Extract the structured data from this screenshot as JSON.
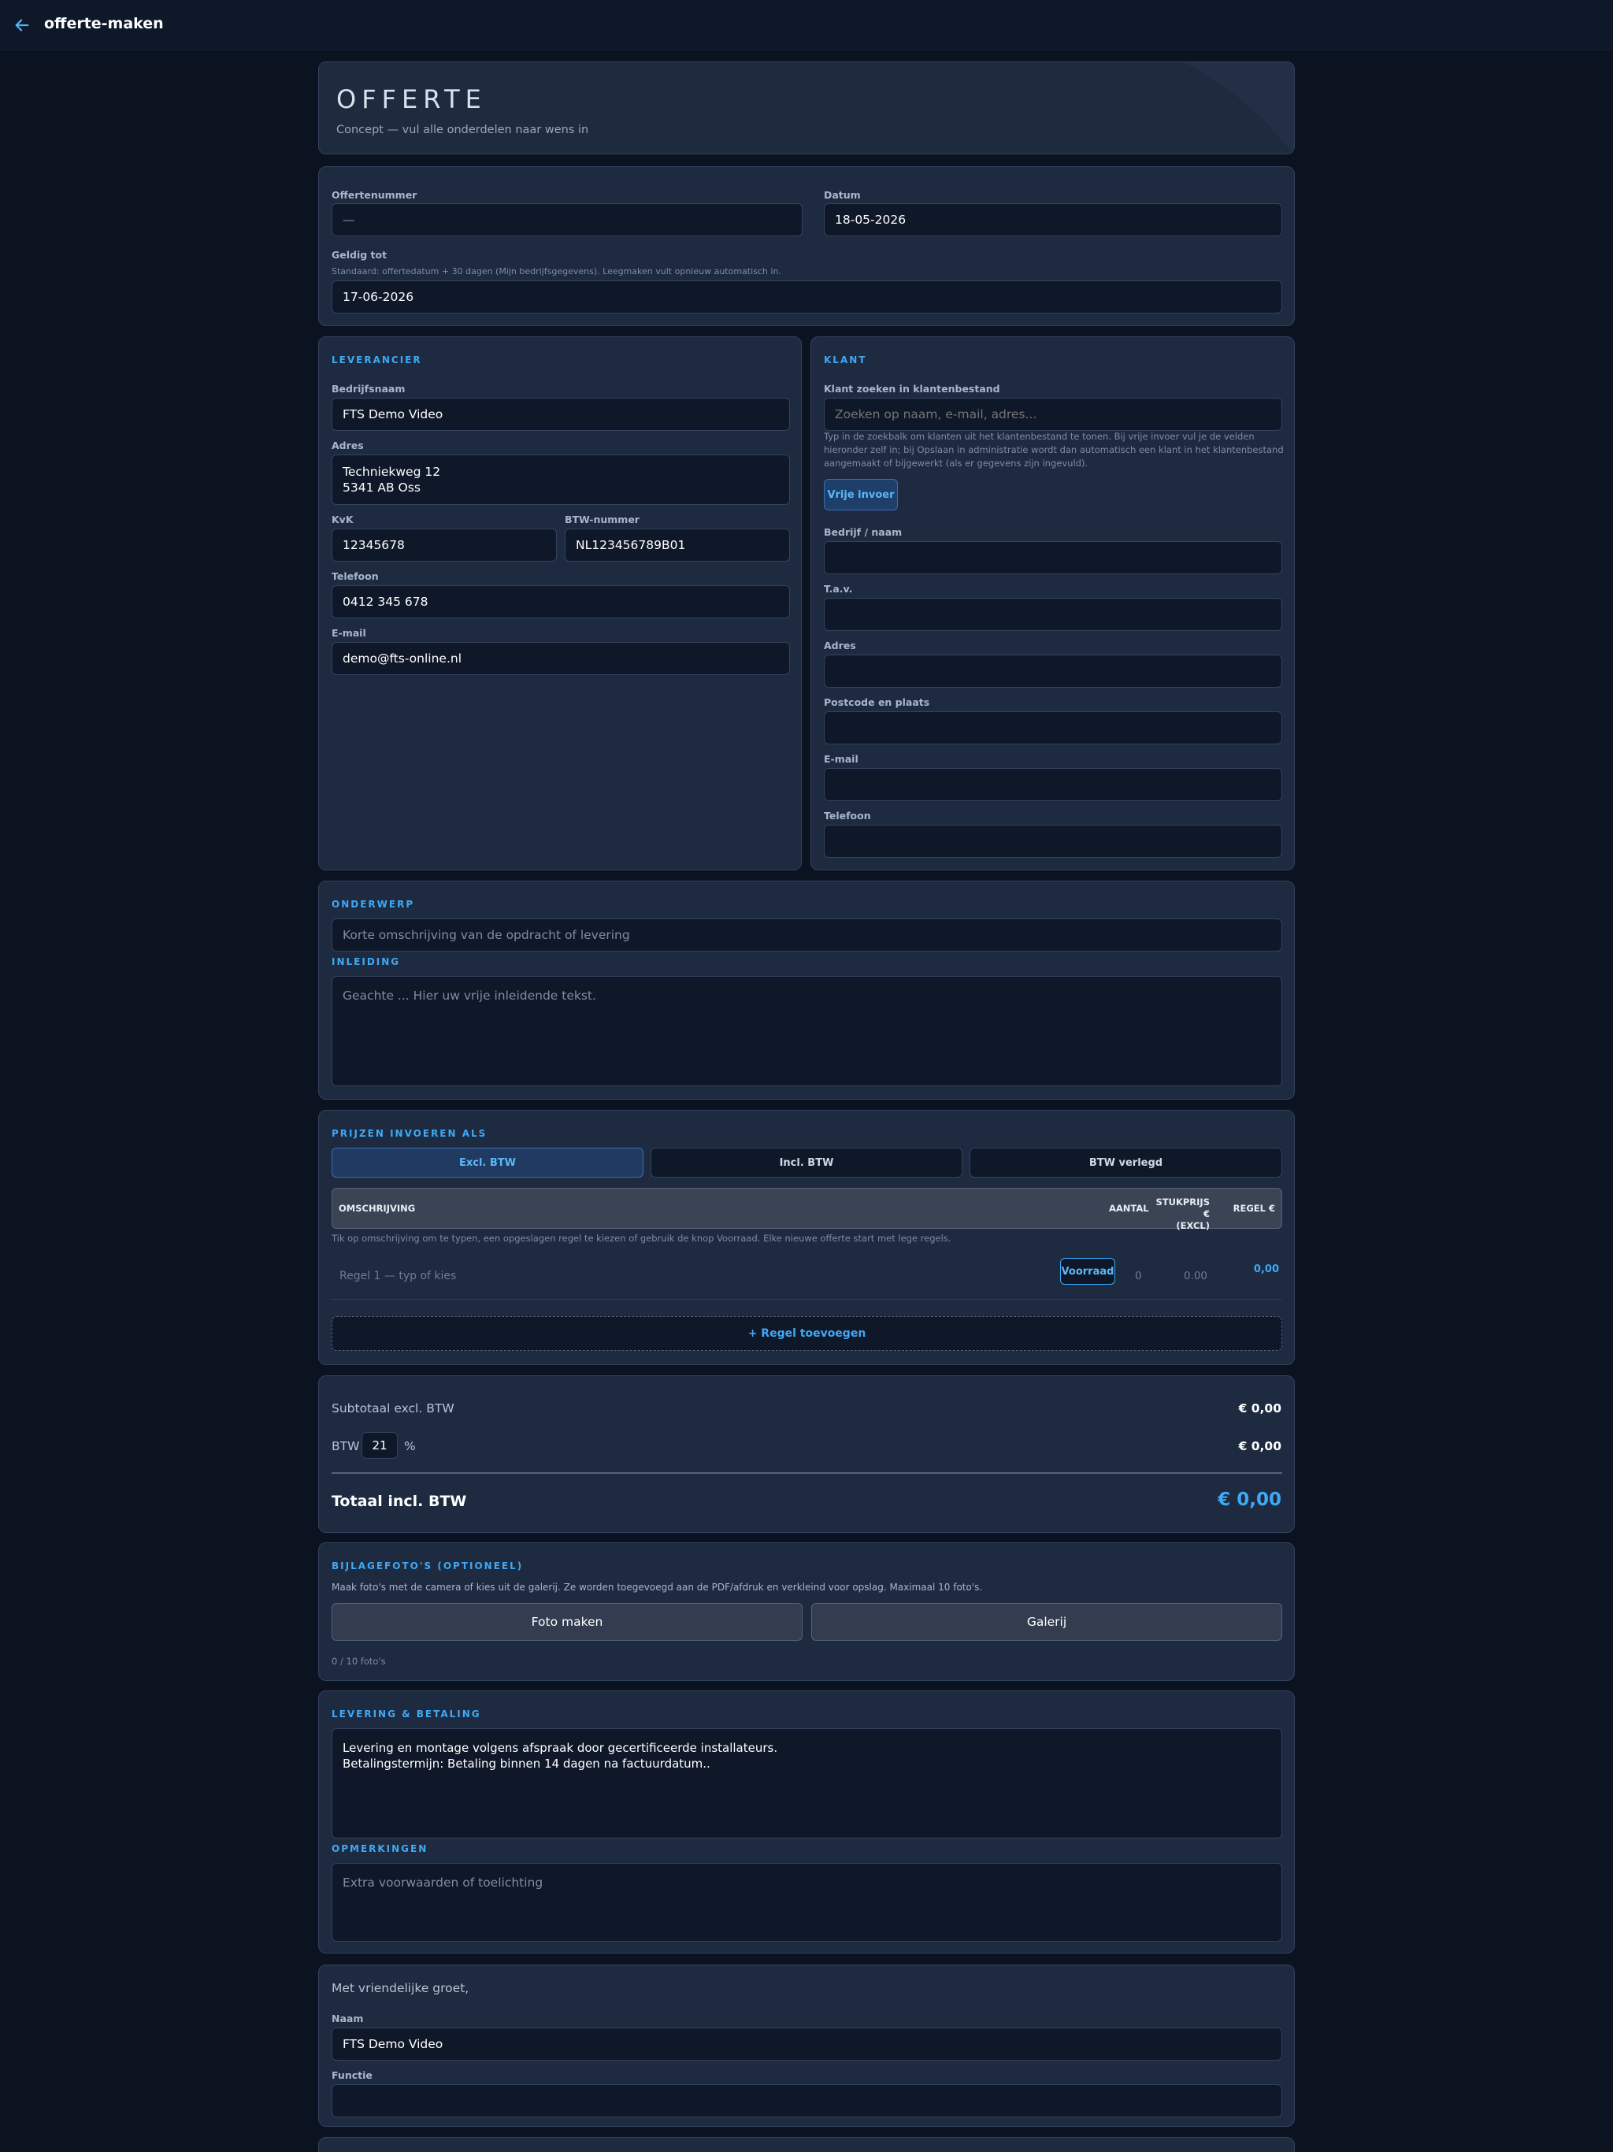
{
  "topbar": {
    "title": "offerte-maken",
    "back_icon": "arrow-left-icon"
  },
  "header": {
    "title": "OFFERTE",
    "subtitle": "Concept — vul alle onderdelen naar wens in"
  },
  "meta": {
    "number_label": "Offertenummer",
    "number_value": "—",
    "date_label": "Datum",
    "date_value": "18-05-2026",
    "valid_label": "Geldig tot",
    "valid_hint": "Standaard: offertedatum + 30 dagen (Mijn bedrijfsgegevens). Leegmaken vult opnieuw automatisch in.",
    "valid_value": "17-06-2026"
  },
  "supplier": {
    "section": "LEVERANCIER",
    "company_label": "Bedrijfsnaam",
    "company_value": "FTS Demo Video",
    "address_label": "Adres",
    "address_value": "Techniekweg 12\n5341 AB Oss",
    "kvk_label": "KvK",
    "kvk_value": "12345678",
    "vat_label": "BTW-nummer",
    "vat_value": "NL123456789B01",
    "phone_label": "Telefoon",
    "phone_value": "0412 345 678",
    "email_label": "E-mail",
    "email_value": "demo@fts-online.nl"
  },
  "client": {
    "section": "KLANT",
    "search_label": "Klant zoeken in klantenbestand",
    "search_placeholder": "Zoeken op naam, e-mail, adres...",
    "search_hint": "Typ in de zoekbalk om klanten uit het klantenbestand te tonen. Bij vrije invoer vul je de velden hieronder zelf in; bij Opslaan in administratie wordt dan automatisch een klant in het klantenbestand aangemaakt of bijgewerkt (als er gegevens zijn ingevuld).",
    "free_entry_label": "Vrije invoer",
    "company_label": "Bedrijf / naam",
    "company_value": "",
    "attn_label": "T.a.v.",
    "attn_value": "",
    "address_label": "Adres",
    "address_value": "",
    "postal_label": "Postcode en plaats",
    "postal_value": "",
    "email_label": "E-mail",
    "email_value": "",
    "phone_label": "Telefoon",
    "phone_value": ""
  },
  "subject": {
    "section": "ONDERWERP",
    "placeholder": "Korte omschrijving van de opdracht of levering",
    "intro_section": "INLEIDING",
    "intro_placeholder": "Geachte ...  Hier uw vrije inleidende tekst."
  },
  "prices": {
    "section": "PRIJZEN INVOEREN ALS",
    "modes": [
      "Excl. BTW",
      "Incl. BTW",
      "BTW verlegd"
    ],
    "active_mode": "Excl. BTW",
    "columns": {
      "description": "OMSCHRIJVING",
      "quantity": "AANTAL",
      "unit_price_1": "STUKPRIJS €",
      "unit_price_2": "(EXCL)",
      "line": "REGEL €"
    },
    "table_hint": "Tik op omschrijving om te typen, een opgeslagen regel te kiezen of gebruik de knop Voorraad. Elke nieuwe offerte start met lege regels.",
    "rows": [
      {
        "description_placeholder": "Regel 1 — typ of kies",
        "stock_label": "Voorraad",
        "quantity": "0",
        "unit_price": "0.00",
        "line_total": "0,00"
      }
    ],
    "add_row_label": "+ Regel toevoegen"
  },
  "totals": {
    "subtotal_label": "Subtotaal excl. BTW",
    "subtotal_value": "€ 0,00",
    "vat_label": "BTW",
    "vat_percent": "21",
    "vat_unit": "%",
    "vat_value": "€ 0,00",
    "total_label": "Totaal incl. BTW",
    "total_value": "€ 0,00"
  },
  "photos": {
    "section": "BIJLAGEFOTO'S (OPTIONEEL)",
    "hint": "Maak foto's met de camera of kies uit de galerij. Ze worden toegevoegd aan de PDF/afdruk en verkleind voor opslag. Maximaal 10 foto's.",
    "camera_label": "Foto maken",
    "gallery_label": "Galerij",
    "count": "0 / 10 foto's"
  },
  "delivery": {
    "section": "LEVERING & BETALING",
    "value": "Levering en montage volgens afspraak door gecertificeerde installateurs.\nBetalingstermijn: Betaling binnen 14 dagen na factuurdatum..",
    "remarks_section": "OPMERKINGEN",
    "remarks_placeholder": "Extra voorwaarden of toelichting"
  },
  "closing": {
    "greeting": "Met vriendelijke groet,",
    "name_label": "Naam",
    "name_value": "FTS Demo Video",
    "role_label": "Functie",
    "role_value": ""
  },
  "colors": {
    "accent": "#3ea9f5",
    "background": "#0b1220",
    "card": "#1d2a40",
    "input": "#0f1829"
  }
}
